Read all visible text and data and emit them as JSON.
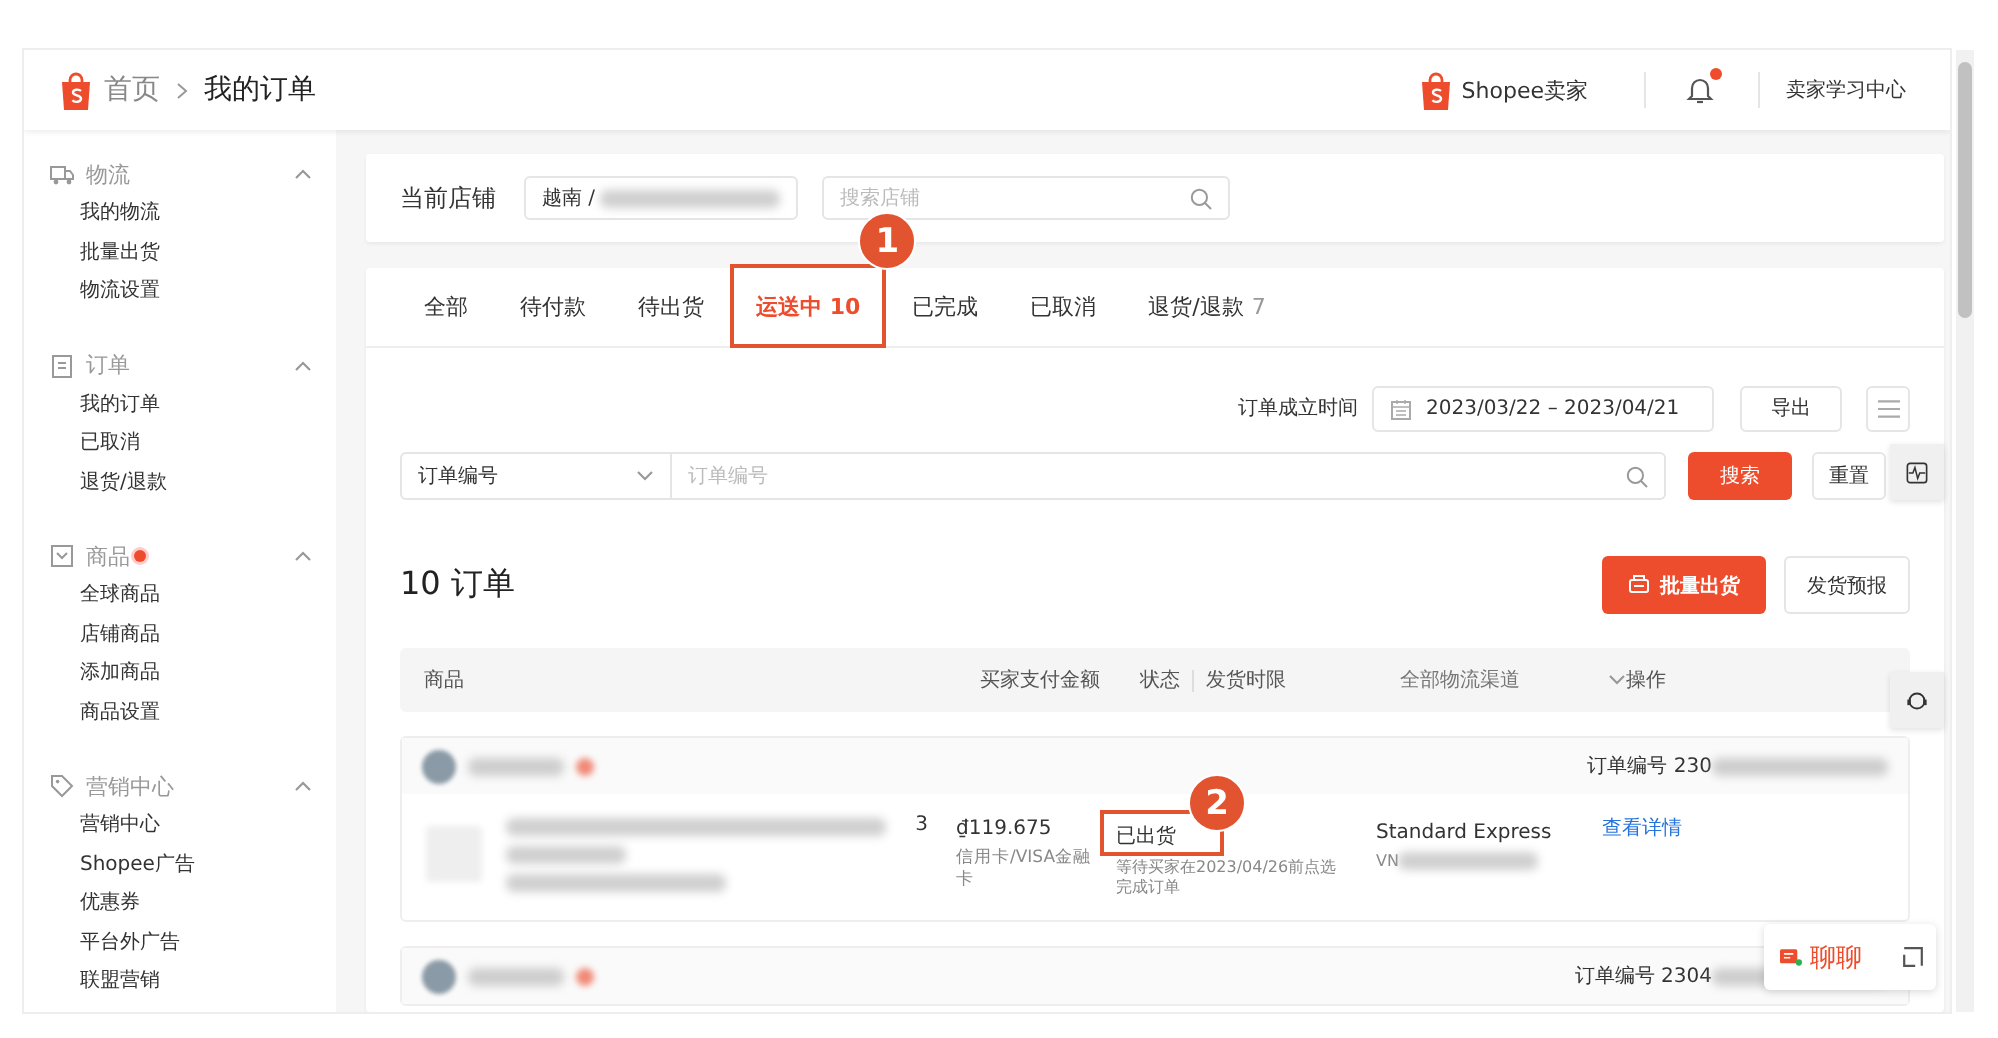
{
  "header": {
    "breadcrumb": [
      {
        "label": "首页"
      },
      {
        "label": "我的订单"
      }
    ],
    "brand": "Shopee卖家",
    "notification_dot": true,
    "learning_center": "卖家学习中心"
  },
  "sidebar": {
    "groups": [
      {
        "label": "物流",
        "expanded": true,
        "dot": false,
        "items": [
          "我的物流",
          "批量出货",
          "物流设置"
        ]
      },
      {
        "label": "订单",
        "expanded": true,
        "dot": false,
        "items": [
          "我的订单",
          "已取消",
          "退货/退款"
        ]
      },
      {
        "label": "商品",
        "expanded": true,
        "dot": true,
        "items": [
          "全球商品",
          "店铺商品",
          "添加商品",
          "商品设置"
        ]
      },
      {
        "label": "营销中心",
        "expanded": true,
        "dot": false,
        "items": [
          "营销中心",
          "Shopee广告",
          "优惠券",
          "平台外广告",
          "联盟营销"
        ]
      }
    ]
  },
  "store": {
    "label": "当前店铺",
    "value": "越南 /",
    "search_placeholder": "搜索店铺"
  },
  "tabs": [
    {
      "label": "全部",
      "selected": false
    },
    {
      "label": "待付款",
      "selected": false
    },
    {
      "label": "待出货",
      "selected": false
    },
    {
      "label": "运送中 10",
      "selected": true,
      "annotation": "1"
    },
    {
      "label": "已完成",
      "selected": false
    },
    {
      "label": "已取消",
      "selected": false
    },
    {
      "label": "退货/退款",
      "count": "7",
      "selected": false
    }
  ],
  "filters": {
    "date_label": "订单成立时间",
    "date_range": "2023/03/22 – 2023/04/21",
    "export": "导出",
    "field_select": "订单编号",
    "field_placeholder": "订单编号",
    "search": "搜索",
    "reset": "重置"
  },
  "order_count": "10 订单",
  "actions": {
    "batch_ship": "批量出货",
    "forecast": "发货预报"
  },
  "table": {
    "columns": [
      "商品",
      "买家支付金额",
      "状态",
      "发货时限",
      "全部物流渠道",
      "操作"
    ]
  },
  "orders": [
    {
      "order_no": "订单编号 230",
      "quantity": "3",
      "amount": "₫119.675",
      "payment": "信用卡/VISA金融卡",
      "status": "已出货",
      "status_annotation": "2",
      "status_note": "等待买家在2023/04/26前点选完成订单",
      "channel": "Standard Express",
      "tracking": "VN",
      "action": "查看详情"
    },
    {
      "order_no": "订单编号 2304"
    }
  ],
  "chat": {
    "label": "聊聊"
  }
}
